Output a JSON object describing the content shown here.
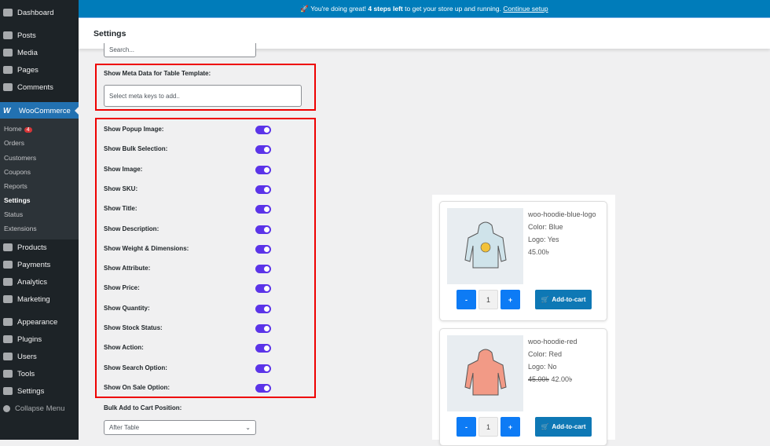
{
  "sidebar": {
    "top": [
      {
        "label": "Dashboard"
      },
      {
        "label": "Posts"
      },
      {
        "label": "Media"
      },
      {
        "label": "Pages"
      },
      {
        "label": "Comments"
      }
    ],
    "woo": "WooCommerce",
    "sub": [
      {
        "label": "Home",
        "badge": "4"
      },
      {
        "label": "Orders"
      },
      {
        "label": "Customers"
      },
      {
        "label": "Coupons"
      },
      {
        "label": "Reports"
      },
      {
        "label": "Settings"
      },
      {
        "label": "Status"
      },
      {
        "label": "Extensions"
      }
    ],
    "bottom": [
      {
        "label": "Products"
      },
      {
        "label": "Payments"
      },
      {
        "label": "Analytics"
      },
      {
        "label": "Marketing"
      },
      {
        "label": "Appearance"
      },
      {
        "label": "Plugins"
      },
      {
        "label": "Users"
      },
      {
        "label": "Tools"
      },
      {
        "label": "Settings"
      },
      {
        "label": "Collapse Menu"
      }
    ]
  },
  "notice": {
    "prefix": "You're doing great!",
    "bold": "4 steps left",
    "suffix": "to get your store up and running.",
    "link": "Continue setup"
  },
  "header": {
    "title": "Settings"
  },
  "form": {
    "search_placeholder": "Search...",
    "meta_label": "Show Meta Data for Table Template:",
    "meta_placeholder": "Select meta keys to add..",
    "toggles": [
      {
        "label": "Show Popup Image:",
        "on": true
      },
      {
        "label": "Show Bulk Selection:",
        "on": true
      },
      {
        "label": "Show Image:",
        "on": true
      },
      {
        "label": "Show SKU:",
        "on": true
      },
      {
        "label": "Show Title:",
        "on": true
      },
      {
        "label": "Show Description:",
        "on": true
      },
      {
        "label": "Show Weight & Dimensions:",
        "on": true
      },
      {
        "label": "Show Attribute:",
        "on": true
      },
      {
        "label": "Show Price:",
        "on": true
      },
      {
        "label": "Show Quantity:",
        "on": true
      },
      {
        "label": "Show Stock Status:",
        "on": true
      },
      {
        "label": "Show Action:",
        "on": true
      },
      {
        "label": "Show Search Option:",
        "on": true
      },
      {
        "label": "Show On Sale Option:",
        "on": true
      }
    ],
    "bulk_label": "Bulk Add to Cart Position:",
    "bulk_value": "After Table"
  },
  "products": [
    {
      "name": "woo-hoodie-blue-logo",
      "color": "Color: Blue",
      "logo": "Logo: Yes",
      "price": "45.00৳",
      "old_price": "",
      "qty": "1",
      "minus": "-",
      "plus": "+",
      "cart": "Add-to-cart",
      "tint": "#cfe3ea"
    },
    {
      "name": "woo-hoodie-red",
      "color": "Color: Red",
      "logo": "Logo: No",
      "price": "42.00৳",
      "old_price": "45.00৳",
      "qty": "1",
      "minus": "-",
      "plus": "+",
      "cart": "Add-to-cart",
      "tint": "#f29a86"
    }
  ]
}
